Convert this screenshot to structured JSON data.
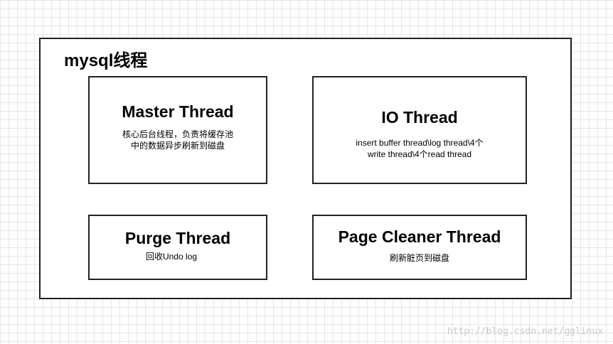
{
  "diagram": {
    "title": "mysql线程",
    "boxes": {
      "master": {
        "title": "Master Thread",
        "desc": [
          "核心后台线程，负责将缓存池",
          "中的数据异步刷新到磁盘"
        ]
      },
      "io": {
        "title": "IO Thread",
        "desc": [
          "insert buffer thread\\log thread\\4个",
          "write thread\\4个read thread"
        ]
      },
      "purge": {
        "title": "Purge Thread",
        "desc": [
          "回收Undo log"
        ]
      },
      "cleaner": {
        "title": "Page Cleaner Thread",
        "desc": [
          "刷新脏页到磁盘"
        ]
      }
    }
  },
  "watermark": "http://blog.csdn.net/gglinux"
}
